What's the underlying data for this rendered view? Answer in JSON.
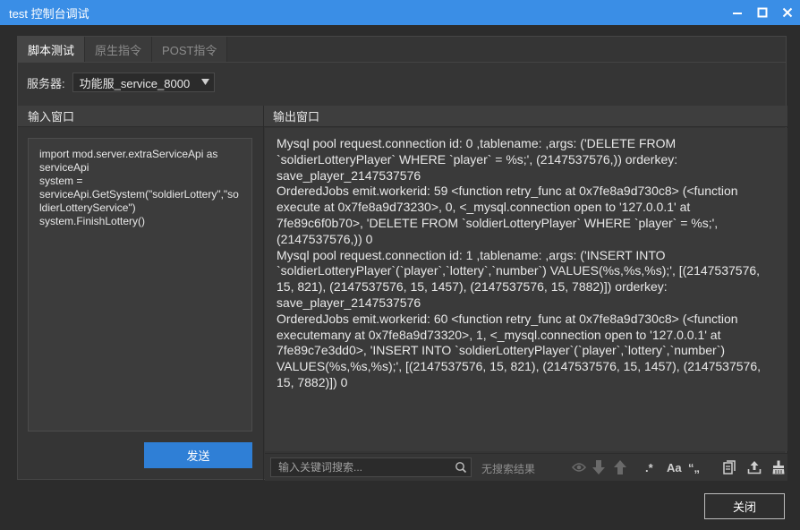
{
  "window": {
    "title": "test 控制台调试"
  },
  "tabs": [
    {
      "label": "脚本测试",
      "active": true
    },
    {
      "label": "原生指令",
      "active": false
    },
    {
      "label": "POST指令",
      "active": false
    }
  ],
  "server": {
    "label": "服务器:",
    "selected": "功能服_service_8000"
  },
  "input_panel": {
    "header": "输入窗口",
    "code": "import mod.server.extraServiceApi as serviceApi\nsystem = serviceApi.GetSystem(\"soldierLottery\",\"soldierLotteryService\")\nsystem.FinishLottery()",
    "send_label": "发送"
  },
  "output_panel": {
    "header": "输出窗口",
    "lines": [
      "Mysql pool request.connection id: 0 ,tablename:  ,args: ('DELETE FROM `soldierLotteryPlayer` WHERE `player` = %s;', (2147537576,)) orderkey: save_player_2147537576",
      "OrderedJobs emit.workerid: 59 <function retry_func at 0x7fe8a9d730c8> (<function execute at 0x7fe8a9d73230>, 0, <_mysql.connection open to '127.0.0.1' at 7fe89c6f0b70>, 'DELETE FROM `soldierLotteryPlayer` WHERE `player` = %s;', (2147537576,)) 0",
      "Mysql pool request.connection id: 1 ,tablename:  ,args: ('INSERT INTO `soldierLotteryPlayer`(`player`,`lottery`,`number`) VALUES(%s,%s,%s);', [(2147537576, 15, 821), (2147537576, 15, 1457), (2147537576, 15, 7882)]) orderkey: save_player_2147537576",
      "OrderedJobs emit.workerid: 60 <function retry_func at 0x7fe8a9d730c8> (<function executemany at 0x7fe8a9d73320>, 1, <_mysql.connection open to '127.0.0.1' at 7fe89c7e3dd0>, 'INSERT INTO `soldierLotteryPlayer`(`player`,`lottery`,`number`) VALUES(%s,%s,%s);', [(2147537576, 15, 821), (2147537576, 15, 1457), (2147537576, 15, 7882)]) 0"
    ]
  },
  "search": {
    "placeholder": "输入关键词搜索...",
    "status": "无搜索结果",
    "regex_label": ".*",
    "case_label": "Aa",
    "word_label": "“„"
  },
  "footer": {
    "close_label": "关闭"
  },
  "colors": {
    "titlebar": "#3a8ee6",
    "primary_button": "#2f7fd6",
    "background": "#2c2c2c"
  }
}
